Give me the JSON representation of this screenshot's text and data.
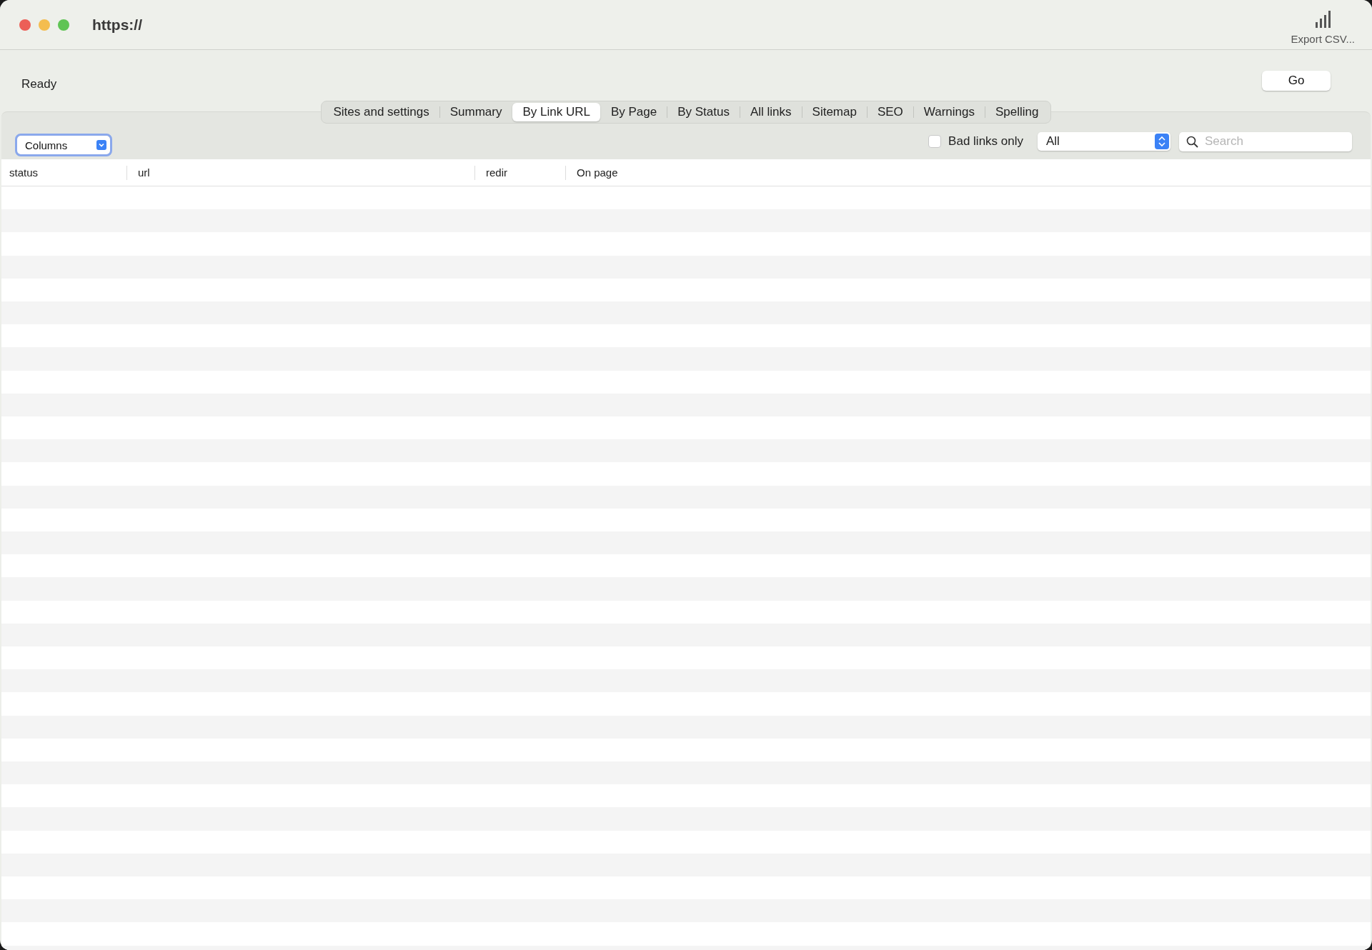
{
  "window": {
    "title": "https://"
  },
  "toolbar": {
    "export_label": "Export CSV..."
  },
  "status": "Ready",
  "go_button": "Go",
  "tabs": [
    {
      "label": "Sites and settings",
      "selected": false
    },
    {
      "label": "Summary",
      "selected": false
    },
    {
      "label": "By Link URL",
      "selected": true
    },
    {
      "label": "By Page",
      "selected": false
    },
    {
      "label": "By Status",
      "selected": false
    },
    {
      "label": "All links",
      "selected": false
    },
    {
      "label": "Sitemap",
      "selected": false
    },
    {
      "label": "SEO",
      "selected": false
    },
    {
      "label": "Warnings",
      "selected": false
    },
    {
      "label": "Spelling",
      "selected": false
    }
  ],
  "columns_popup": "Columns",
  "bad_links_only": {
    "label": "Bad links only",
    "checked": false
  },
  "filter_select": "All",
  "search": {
    "placeholder": "Search"
  },
  "table": {
    "columns": [
      {
        "label": "status"
      },
      {
        "label": "url"
      },
      {
        "label": "redir"
      },
      {
        "label": "On page"
      }
    ]
  }
}
